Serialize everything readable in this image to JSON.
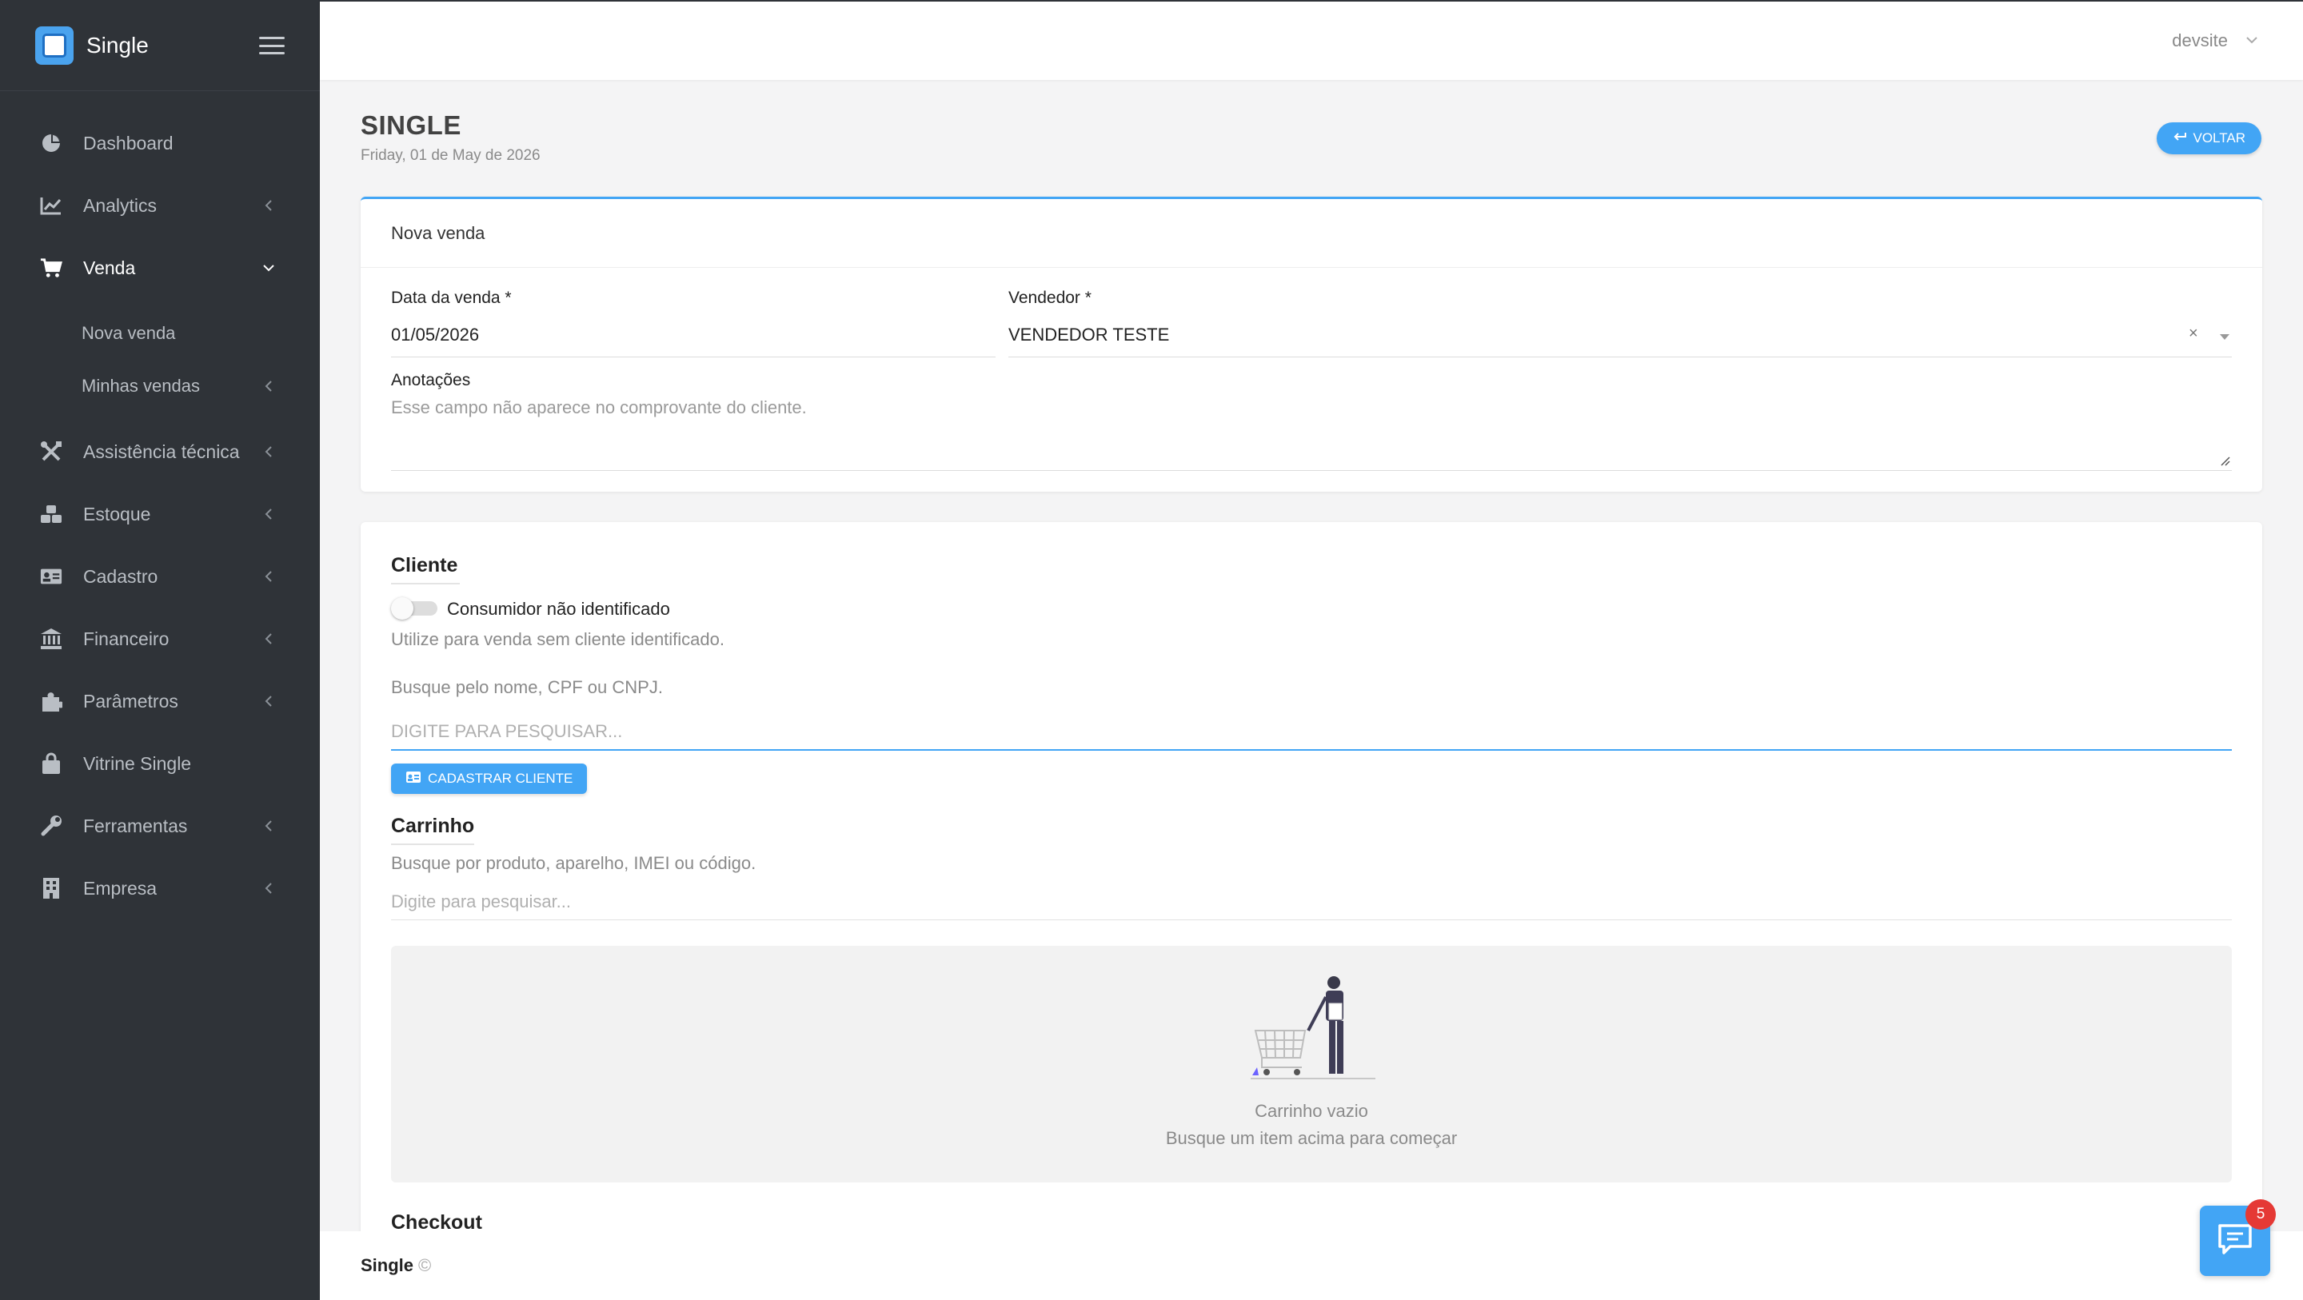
{
  "app": {
    "brand": "Single"
  },
  "sidebar": {
    "items": [
      {
        "label": "Dashboard",
        "icon": "pie-chart-icon"
      },
      {
        "label": "Analytics",
        "icon": "line-chart-icon"
      },
      {
        "label": "Venda",
        "icon": "cart-icon",
        "sub": [
          "Nova venda",
          "Minhas vendas"
        ]
      },
      {
        "label": "Assistência técnica",
        "icon": "tools-icon"
      },
      {
        "label": "Estoque",
        "icon": "boxes-icon"
      },
      {
        "label": "Cadastro",
        "icon": "id-card-icon"
      },
      {
        "label": "Financeiro",
        "icon": "bank-icon"
      },
      {
        "label": "Parâmetros",
        "icon": "puzzle-icon"
      },
      {
        "label": "Vitrine Single",
        "icon": "shopping-bag-icon"
      },
      {
        "label": "Ferramentas",
        "icon": "wrench-icon"
      },
      {
        "label": "Empresa",
        "icon": "building-icon"
      }
    ]
  },
  "topbar": {
    "user": "devsite"
  },
  "page": {
    "title": "SINGLE",
    "date": "Friday, 01 de May de 2026",
    "back_label": "VOLTAR"
  },
  "sale": {
    "card_title": "Nova venda",
    "date_label": "Data da venda *",
    "date_value": "01/05/2026",
    "seller_label": "Vendedor *",
    "seller_value": "VENDEDOR TESTE",
    "clear_symbol": "×",
    "notes_label": "Anotações",
    "notes_placeholder": "Esse campo não aparece no comprovante do cliente."
  },
  "client": {
    "title": "Cliente",
    "toggle_label": "Consumidor não identificado",
    "toggle_on": false,
    "toggle_hint": "Utilize para venda sem cliente identificado.",
    "search_hint": "Busque pelo nome, CPF ou CNPJ.",
    "search_placeholder": "DIGITE PARA PESQUISAR...",
    "register_label": "CADASTRAR CLIENTE"
  },
  "cart": {
    "title": "Carrinho",
    "search_hint": "Busque por produto, aparelho, IMEI ou código.",
    "search_placeholder": "Digite para pesquisar...",
    "empty_title": "Carrinho vazio",
    "empty_subtitle": "Busque um item acima para começar"
  },
  "checkout": {
    "title": "Checkout"
  },
  "footer": {
    "name": "Single",
    "copyright": "©"
  },
  "chat": {
    "badge": "5"
  },
  "colors": {
    "accent": "#42a5f5",
    "sidebar": "#2f3338",
    "badge": "#e53935"
  }
}
